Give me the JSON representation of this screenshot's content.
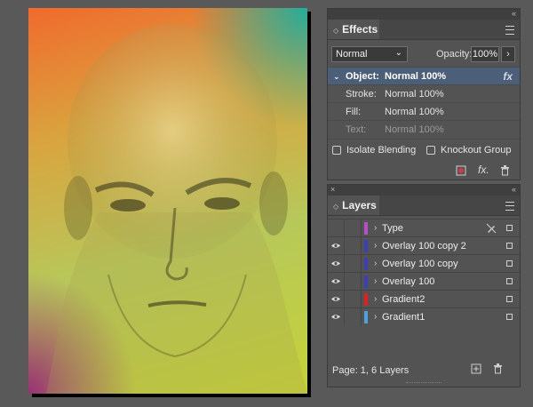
{
  "effects": {
    "title": "Effects",
    "blend_mode": "Normal",
    "opacity_label": "Opacity:",
    "opacity_value": "100%",
    "rows": [
      {
        "label": "Object:",
        "value": "Normal 100%",
        "selected": true,
        "fx": "fx"
      },
      {
        "label": "Stroke:",
        "value": "Normal 100%"
      },
      {
        "label": "Fill:",
        "value": "Normal 100%"
      },
      {
        "label": "Text:",
        "value": "Normal 100%",
        "dimmed": true
      }
    ],
    "isolate_label": "Isolate Blending",
    "knockout_label": "Knockout Group"
  },
  "layers": {
    "title": "Layers",
    "items": [
      {
        "name": "Type",
        "color": "#b44fc7",
        "visible": false,
        "locked": false
      },
      {
        "name": "Overlay 100 copy 2",
        "color": "#3c3fb5",
        "visible": true
      },
      {
        "name": "Overlay 100 copy",
        "color": "#3c3fb5",
        "visible": true
      },
      {
        "name": "Overlay 100",
        "color": "#3c3fb5",
        "visible": true
      },
      {
        "name": "Gradient2",
        "color": "#e32020",
        "visible": true
      },
      {
        "name": "Gradient1",
        "color": "#4fa1de",
        "visible": true
      }
    ],
    "footer": "Page: 1, 6 Layers"
  },
  "icons": {
    "collapse": "«",
    "close": "×",
    "caret": "◇",
    "layer_toggle": "›"
  }
}
